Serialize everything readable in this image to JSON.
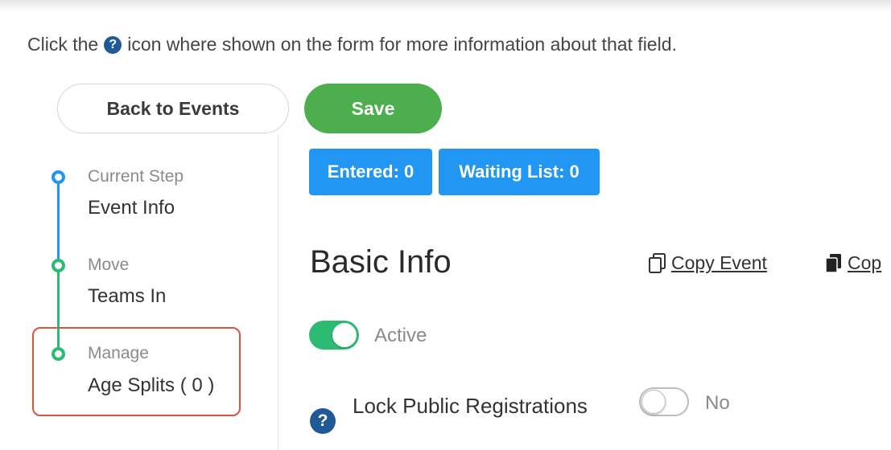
{
  "help": {
    "prefix": "Click the",
    "icon": "question-circle-icon",
    "suffix": "icon where shown on the form for more information about that field."
  },
  "nav": {
    "back_label": "Back to Events",
    "save_label": "Save"
  },
  "steps": [
    {
      "label": "Current Step",
      "title": "Event Info",
      "color": "#2196f3"
    },
    {
      "label": "Move",
      "title": "Teams In",
      "color": "#2bbb72"
    },
    {
      "label": "Manage",
      "title": "Age Splits ( 0 )",
      "color": "#2bbb72"
    }
  ],
  "badges": {
    "entered": "Entered: 0",
    "waiting": "Waiting List: 0"
  },
  "section": {
    "title": "Basic Info",
    "copy_event": "Copy Event",
    "copy_other": "Cop"
  },
  "active_toggle": {
    "state": "on",
    "label": "Active"
  },
  "lock_public": {
    "label": "Lock Public Registrations",
    "state": "off",
    "value_label": "No"
  },
  "colors": {
    "primary": "#2196f3",
    "success": "#4cae4c",
    "step_green": "#2bbb72",
    "highlight": "#d9553f",
    "help_icon": "#1f5a96"
  }
}
